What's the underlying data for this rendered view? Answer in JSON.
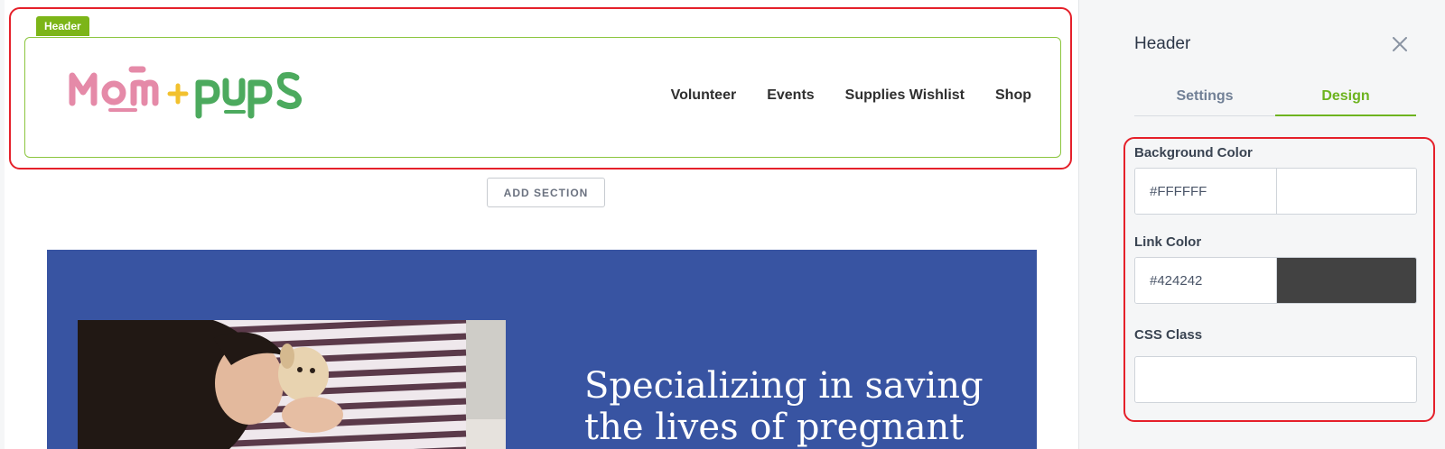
{
  "canvas": {
    "header_tag": "Header",
    "logo": {
      "part1": "Mom",
      "plus": "+",
      "part2": "pups",
      "colors": {
        "mom": "#e58aa8",
        "plus": "#f2c12e",
        "pups": "#4caa5e"
      }
    },
    "nav": [
      {
        "label": "Volunteer"
      },
      {
        "label": "Events"
      },
      {
        "label": "Supplies Wishlist"
      },
      {
        "label": "Shop"
      }
    ],
    "add_section_label": "ADD SECTION",
    "hero": {
      "background": "#3854a2",
      "title": "Specializing in saving the lives of pregnant",
      "photo_icon": "woman-with-puppy-photo"
    }
  },
  "panel": {
    "title": "Header",
    "close_icon": "close-icon",
    "tabs": [
      {
        "label": "Settings",
        "active": false
      },
      {
        "label": "Design",
        "active": true
      }
    ],
    "background_color": {
      "label": "Background Color",
      "value": "#FFFFFF",
      "swatch": "#ffffff"
    },
    "link_color": {
      "label": "Link Color",
      "value": "#424242",
      "swatch": "#424242"
    },
    "css_class": {
      "label": "CSS Class",
      "value": ""
    }
  },
  "colors": {
    "accent": "#6db31f",
    "highlight": "#e5202a",
    "tag": "#7cb518"
  }
}
